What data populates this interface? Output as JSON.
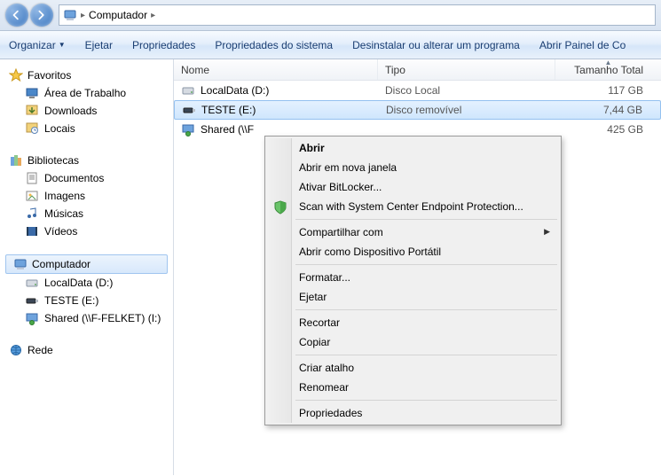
{
  "breadcrumb": {
    "label": "Computador"
  },
  "toolbar": {
    "organize": "Organizar",
    "eject": "Ejetar",
    "properties": "Propriedades",
    "sysprops": "Propriedades do sistema",
    "uninstall": "Desinstalar ou alterar um programa",
    "controlpanel": "Abrir Painel de Co"
  },
  "columns": {
    "name": "Nome",
    "type": "Tipo",
    "total": "Tamanho Total"
  },
  "sidebar": {
    "favorites": {
      "label": "Favoritos",
      "items": [
        {
          "label": "Área de Trabalho"
        },
        {
          "label": "Downloads"
        },
        {
          "label": "Locais"
        }
      ]
    },
    "libraries": {
      "label": "Bibliotecas",
      "items": [
        {
          "label": "Documentos"
        },
        {
          "label": "Imagens"
        },
        {
          "label": "Músicas"
        },
        {
          "label": "Vídeos"
        }
      ]
    },
    "computer": {
      "label": "Computador",
      "items": [
        {
          "label": "LocalData (D:)"
        },
        {
          "label": "TESTE (E:)"
        },
        {
          "label": "Shared (\\\\F-FELKET) (I:)"
        }
      ]
    },
    "network": {
      "label": "Rede"
    }
  },
  "rows": [
    {
      "name": "LocalData (D:)",
      "type": "Disco Local",
      "size": "117 GB",
      "icon": "hdd"
    },
    {
      "name": "TESTE (E:)",
      "type": "Disco removível",
      "size": "7,44 GB",
      "icon": "usb",
      "selected": true
    },
    {
      "name": "Shared (\\\\F",
      "type": "",
      "size": "425 GB",
      "icon": "netdrive"
    }
  ],
  "context_menu": [
    {
      "label": "Abrir",
      "bold": true
    },
    {
      "label": "Abrir em nova janela"
    },
    {
      "label": "Ativar BitLocker..."
    },
    {
      "label": "Scan with System Center Endpoint Protection...",
      "icon": "shield"
    },
    {
      "sep": true
    },
    {
      "label": "Compartilhar com",
      "submenu": true
    },
    {
      "label": "Abrir como Dispositivo Portátil"
    },
    {
      "sep": true
    },
    {
      "label": "Formatar..."
    },
    {
      "label": "Ejetar"
    },
    {
      "sep": true
    },
    {
      "label": "Recortar"
    },
    {
      "label": "Copiar"
    },
    {
      "sep": true
    },
    {
      "label": "Criar atalho"
    },
    {
      "label": "Renomear"
    },
    {
      "sep": true
    },
    {
      "label": "Propriedades"
    }
  ]
}
